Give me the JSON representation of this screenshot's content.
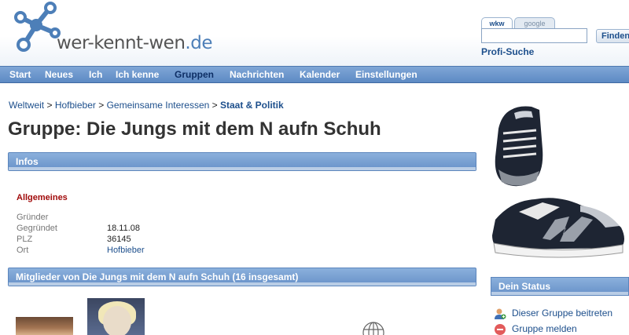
{
  "header": {
    "logo_text": "wer-kennt-wen",
    "logo_tld": ".de",
    "search": {
      "tab_active": "wkw",
      "tab_inactive": "google",
      "input_value": "",
      "button_label": "Finden",
      "profi_link": "Profi-Suche"
    }
  },
  "nav": {
    "items": [
      "Start",
      "Neues",
      "Ich",
      "Ich kenne",
      "Gruppen",
      "Nachrichten",
      "Kalender",
      "Einstellungen"
    ],
    "active": "Gruppen"
  },
  "breadcrumb": {
    "items": [
      "Weltweit",
      "Hofbieber",
      "Gemeinsame Interessen"
    ],
    "separator": ">",
    "current": "Staat & Politik"
  },
  "page": {
    "title": "Gruppe: Die Jungs mit dem N aufn Schuh",
    "infos_section": "Infos",
    "subheading": "Allgemeines",
    "info": {
      "gruender_label": "Gründer",
      "gruender_value": "",
      "gegruendet_label": "Gegründet",
      "gegruendet_value": "18.11.08",
      "plz_label": "PLZ",
      "plz_value": "36145",
      "ort_label": "Ort",
      "ort_value": "Hofbieber"
    },
    "members_section": "Mitglieder von Die Jungs mit dem N aufn Schuh (16 insgesamt)"
  },
  "sidebar": {
    "status_title": "Dein Status",
    "join_link": "Dieser Gruppe beitreten",
    "report_link": "Gruppe melden"
  },
  "colors": {
    "nav_blue": "#5d8ac4",
    "link_blue": "#1d4f8c",
    "subheading_red": "#a10b0b"
  }
}
